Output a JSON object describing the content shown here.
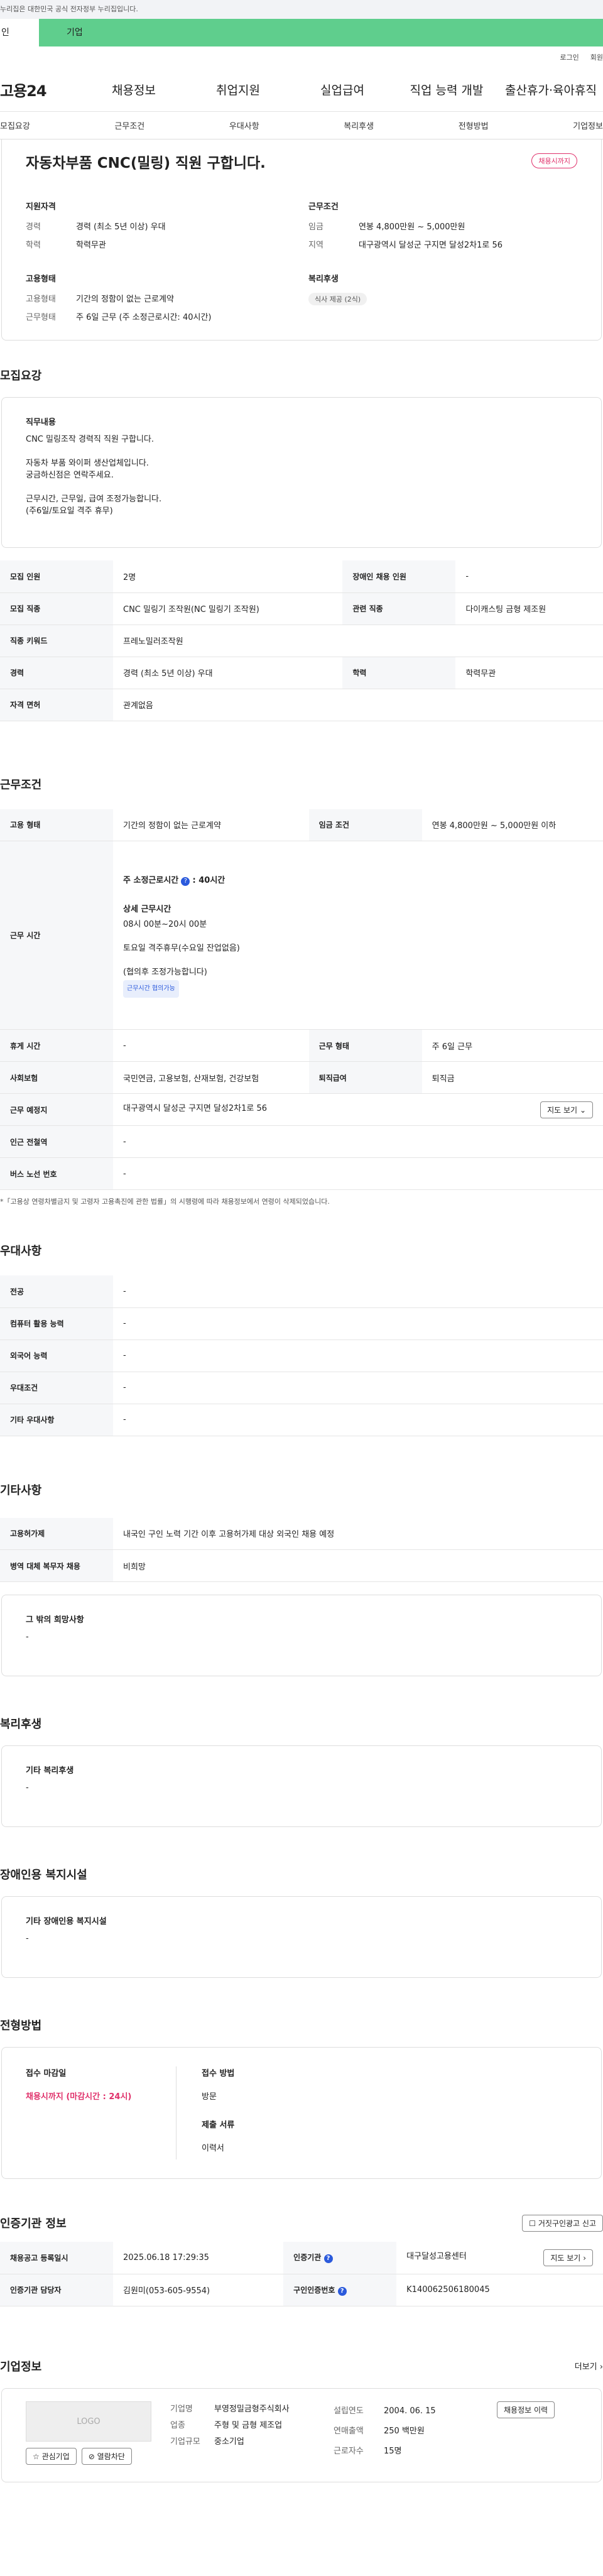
{
  "gov_notice": "누리집은 대한민국 공식 전자정부 누리집입니다.",
  "userbar": {
    "person": "인",
    "corp": "기업"
  },
  "util": [
    "로그인",
    "회원"
  ],
  "logo": "고용24",
  "gnb": [
    "채용정보",
    "취업지원",
    "실업급여",
    "직업 능력 개발",
    "출산휴가·육아휴직"
  ],
  "subnav": [
    "모집요강",
    "근무조건",
    "우대사항",
    "복리후생",
    "전형방법",
    "기업정보"
  ],
  "job": {
    "title": "자동차부품 CNC(밀링) 직원 구합니다.",
    "badge": "채용시까지"
  },
  "summary": {
    "qual_h": "지원자격",
    "career_k": "경력",
    "career_v": "경력 (최소 5년 이상) 우대",
    "edu_k": "학력",
    "edu_v": "학력무관",
    "cond_h": "근무조건",
    "wage_k": "임금",
    "wage_v": "연봉 4,800만원 ~ 5,000만원",
    "loc_k": "지역",
    "loc_v": "대구광역시 달성군 구지면 달성2차1로 56",
    "emp_h": "고용형태",
    "type_k": "고용형태",
    "type_v": "기간의 정함이 없는 근로계약",
    "shift_k": "근무형태",
    "shift_v": "주 6일 근무 (주 소정근로시간: 40시간)",
    "wel_h": "복리후생",
    "wel_chip": "식사 제공 (2식)"
  },
  "recruit": {
    "h": "모집요강",
    "duty_h": "직무내용",
    "duty_lines": [
      "CNC 밀링조작 경력직 직원 구합니다.",
      "",
      "자동차 부품 와이퍼 생산업체입니다.",
      "궁금하신점은 연락주세요.",
      "",
      "근무시간, 근무일, 급여 조정가능합니다.",
      "(주6일/토요일 격주 휴무)"
    ],
    "rows": [
      [
        "모집 인원",
        "2명",
        "장애인 채용 인원",
        "-"
      ],
      [
        "모집 직종",
        "CNC 밀링기 조작원(NC 밀링기 조작원)",
        "관련 직종",
        "다이캐스팅 금형 제조원"
      ],
      [
        "직종 키워드",
        "프레노밀러조작원",
        "",
        ""
      ],
      [
        "경력",
        "경력 (최소 5년 이상) 우대",
        "학력",
        "학력무관"
      ],
      [
        "자격 면허",
        "관계없음",
        "",
        ""
      ]
    ]
  },
  "work": {
    "h": "근무조건",
    "r1": [
      "고용 형태",
      "기간의 정함이 없는 근로계약",
      "임금 조건",
      "연봉 4,800만원 ~ 5,000만원 이하"
    ],
    "time_k": "근무 시간",
    "time_week": "주 소정근로시간",
    "time_week_v": ": 40시간",
    "time_detail_h": "상세 근무시간",
    "time_detail": "08시 00분~20시 00분",
    "time_sat": "토요일 격주휴무(수요일 잔업없음)",
    "time_adj": "(협의후 조정가능합니다)",
    "time_tag": "근무시간 협의가능",
    "r2": [
      "휴게 시간",
      "-",
      "근무 형태",
      "주 6일 근무"
    ],
    "r3": [
      "사회보험",
      "국민연금, 고용보험, 산재보험, 건강보험",
      "퇴직급여",
      "퇴직금"
    ],
    "r4": [
      "근무 예정지",
      "대구광역시 달성군 구지면 달성2차1로 56"
    ],
    "map_btn": "지도 보기",
    "r5": [
      "인근 전철역",
      "-"
    ],
    "r6": [
      "버스 노선 번호",
      "-"
    ],
    "note": "*「고용상 연령차별금지 및 고령자 고용촉진에 관한 법률」의 시행령에 따라 채용정보에서 연령이 삭제되었습니다."
  },
  "pref": {
    "h": "우대사항",
    "rows": [
      [
        "전공",
        "-"
      ],
      [
        "컴퓨터 활용 능력",
        "-"
      ],
      [
        "외국어 능력",
        "-"
      ],
      [
        "우대조건",
        "-"
      ],
      [
        "기타 우대사항",
        "-"
      ]
    ]
  },
  "etc": {
    "h": "기타사항",
    "rows": [
      [
        "고용허가제",
        "내국인 구인 노력 기간 이후 고용허가제 대상 외국인 채용 예정"
      ],
      [
        "병역 대체 복무자 채용",
        "비희망"
      ]
    ],
    "other_h": "그 밖의 희망사항",
    "other_v": "-"
  },
  "welfare": {
    "h": "복리후생",
    "t": "기타 복리후생",
    "v": "-"
  },
  "disab": {
    "h": "장애인용 복지시설",
    "t": "기타 장애인용 복지시설",
    "v": "-"
  },
  "proc": {
    "h": "전형방법",
    "dead_h": "접수 마감일",
    "dead_v": "채용시까지 (마감시간 : 24시)",
    "method_h": "접수 방법",
    "method_v": "방문",
    "doc_h": "제출 서류",
    "doc_v": "이력서"
  },
  "auth": {
    "h": "인증기관 정보",
    "report_btn": "거짓구인광고 신고",
    "r1": [
      "채용공고 등록일시",
      "2025.06.18 17:29:35",
      "인증기관",
      "대구달성고용센터"
    ],
    "map_btn": "지도 보기",
    "r2": [
      "인증기관 담당자",
      "김원미(053-605-9554)",
      "구인인증번호",
      "K140062506180045"
    ]
  },
  "corp": {
    "h": "기업정보",
    "more": "더보기",
    "logo": "LOGO",
    "fav": "관심기업",
    "block": "열람차단",
    "name_k": "기업명",
    "name_v": "부영정밀금형주식회사",
    "ind_k": "업종",
    "ind_v": "주형 및 금형 제조업",
    "size_k": "기업규모",
    "size_v": "중소기업",
    "est_k": "설립연도",
    "est_v": "2004. 06. 15",
    "sales_k": "연매출액",
    "sales_v": "250 백만원",
    "emp_k": "근로자수",
    "emp_v": "15명",
    "jobs_btn": "채용정보 이력"
  }
}
